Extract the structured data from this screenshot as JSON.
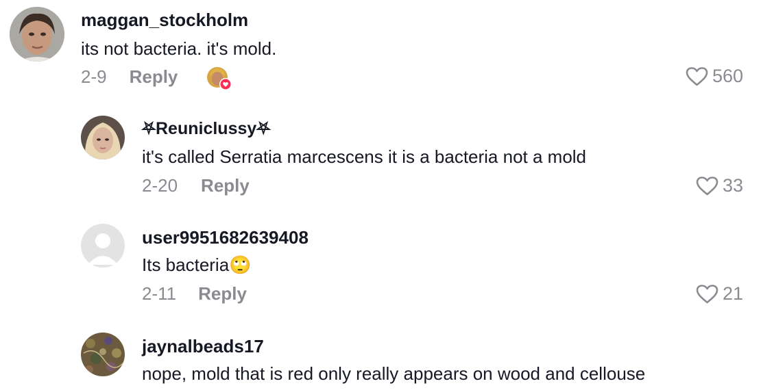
{
  "comments": [
    {
      "username": "maggan_stockholm",
      "text": "its not bacteria. it's mold.",
      "date": "2-9",
      "reply_label": "Reply",
      "likes": "560",
      "avatar": "woman-photo",
      "creator_liked": true
    },
    {
      "username": "⛧Reuniclussy⛧",
      "text": "it's called Serratia marcescens it is a bacteria not a mold",
      "date": "2-20",
      "reply_label": "Reply",
      "likes": "33",
      "avatar": "blonde-photo"
    },
    {
      "username": "user9951682639408",
      "text": "Its bacteria🙄",
      "date": "2-11",
      "reply_label": "Reply",
      "likes": "21",
      "avatar": "default-avatar"
    },
    {
      "username": "jaynalbeads17",
      "text": "nope, mold that is red only really appears on wood and cellouse",
      "avatar": "beads-photo"
    }
  ],
  "colors": {
    "text": "#161823",
    "muted": "#8a8b91",
    "heart_badge": "#fe2c55"
  }
}
